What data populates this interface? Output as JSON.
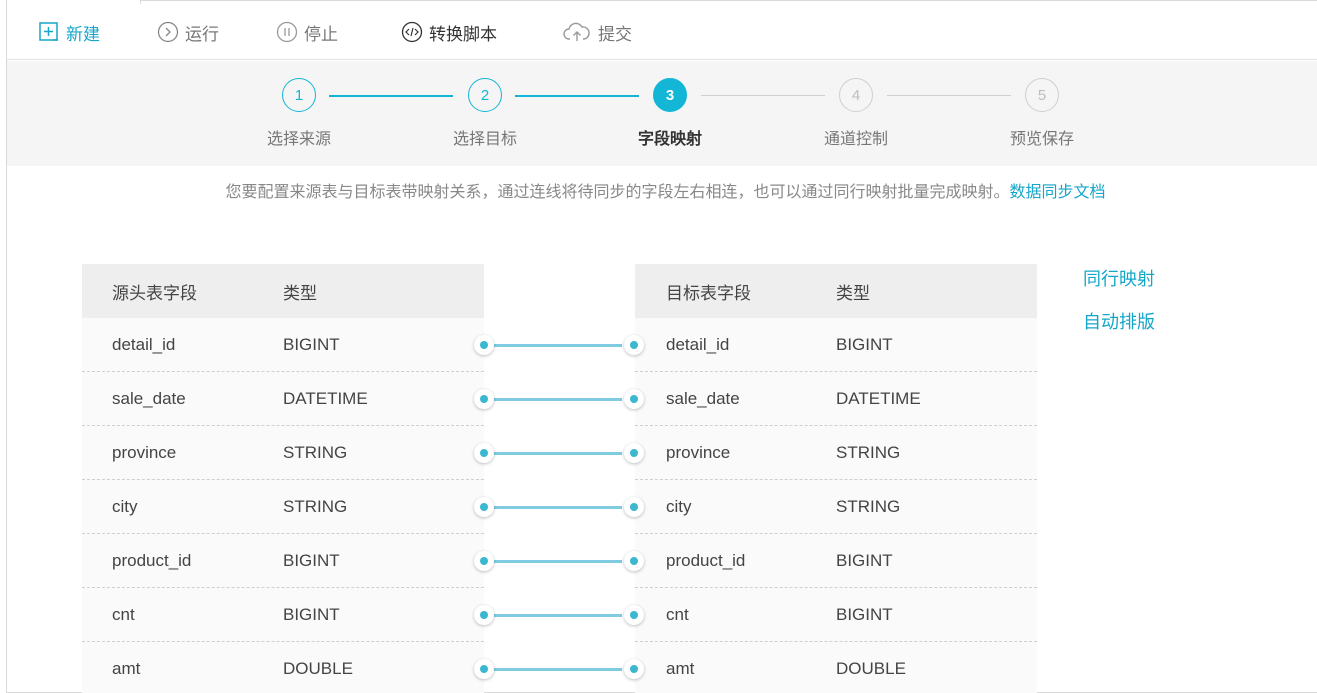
{
  "toolbar": {
    "new_label": "新建",
    "run_label": "运行",
    "stop_label": "停止",
    "convert_label": "转换脚本",
    "submit_label": "提交"
  },
  "steps": [
    {
      "num": "1",
      "label": "选择来源",
      "state": "done"
    },
    {
      "num": "2",
      "label": "选择目标",
      "state": "done"
    },
    {
      "num": "3",
      "label": "字段映射",
      "state": "active"
    },
    {
      "num": "4",
      "label": "通道控制",
      "state": "pending"
    },
    {
      "num": "5",
      "label": "预览保存",
      "state": "pending"
    }
  ],
  "hint": {
    "text": "您要配置来源表与目标表带映射关系，通过连线将待同步的字段左右相连，也可以通过同行映射批量完成映射。",
    "link": "数据同步文档"
  },
  "side_actions": {
    "same_row": "同行映射",
    "auto_layout": "自动排版"
  },
  "source_table": {
    "headers": [
      "源头表字段",
      "类型"
    ],
    "rows": [
      [
        "detail_id",
        "BIGINT"
      ],
      [
        "sale_date",
        "DATETIME"
      ],
      [
        "province",
        "STRING"
      ],
      [
        "city",
        "STRING"
      ],
      [
        "product_id",
        "BIGINT"
      ],
      [
        "cnt",
        "BIGINT"
      ],
      [
        "amt",
        "DOUBLE"
      ]
    ]
  },
  "target_table": {
    "headers": [
      "目标表字段",
      "类型"
    ],
    "rows": [
      [
        "detail_id",
        "BIGINT"
      ],
      [
        "sale_date",
        "DATETIME"
      ],
      [
        "province",
        "STRING"
      ],
      [
        "city",
        "STRING"
      ],
      [
        "product_id",
        "BIGINT"
      ],
      [
        "cnt",
        "BIGINT"
      ],
      [
        "amt",
        "DOUBLE"
      ]
    ]
  },
  "colors": {
    "accent": "#14b6d6",
    "link": "#14a6c9",
    "connector": "#7fcbe0"
  }
}
